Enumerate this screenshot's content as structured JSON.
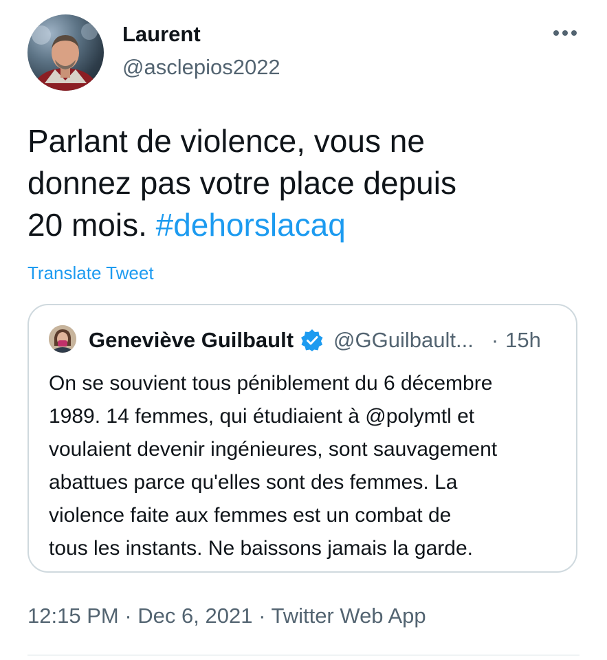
{
  "author": {
    "name": "Laurent",
    "handle": "@asclepios2022"
  },
  "tweet": {
    "text_lines": [
      "Parlant de violence, vous ne",
      "donnez pas votre place depuis",
      "20 mois. "
    ],
    "hashtag": "#dehorslacaq",
    "translate_label": "Translate Tweet"
  },
  "quoted_tweet": {
    "name": "Geneviève Guilbault",
    "handle": "@GGuilbault...",
    "separator": "·",
    "time": "15h",
    "text_lines": [
      "On se souvient tous péniblement du 6 décembre",
      "1989. 14 femmes, qui étudiaient à @polymtl et",
      "voulaient devenir ingénieures, sont sauvagement",
      "abattues parce qu'elles sont des femmes. La",
      "violence faite aux femmes est un combat de",
      "tous les instants. Ne baissons jamais la garde."
    ]
  },
  "meta": {
    "time": "12:15 PM",
    "separator": "·",
    "date": "Dec 6, 2021",
    "source": "Twitter Web App"
  },
  "icons": {
    "more": "more-horizontal-icon",
    "verified": "verified-badge-icon"
  },
  "colors": {
    "accent": "#1d9bf0",
    "text": "#0f1419",
    "secondary": "#536471",
    "border": "#cfd9de"
  }
}
